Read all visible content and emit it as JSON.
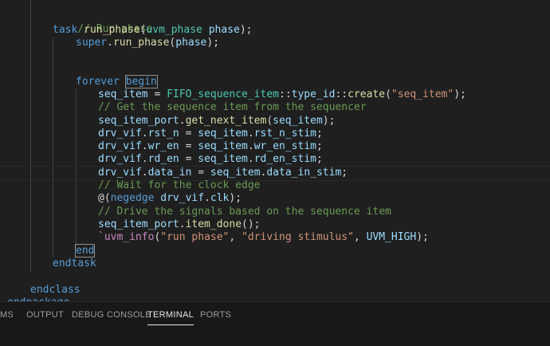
{
  "code": {
    "c1": "// Run phase",
    "task_kw": "task",
    "task_fn": "run_phase",
    "task_type": "uvm_phase",
    "task_arg": "phase",
    "super_kw": "super",
    "super_call": "run_phase",
    "super_arg": "phase",
    "forever_kw": "forever",
    "begin_kw": "begin",
    "seq_item": "seq_item",
    "fifo_type": "FIFO_sequence_item",
    "type_id": "type_id",
    "create_fn": "create",
    "seq_str": "\"seq_item\"",
    "c2": "// Get the sequence item from the sequencer",
    "port": "seq_item_port",
    "get_next": "get_next_item",
    "drv_vif": "drv_vif",
    "rst_n": "rst_n",
    "rst_n_stim": "rst_n_stim",
    "wr_en": "wr_en",
    "wr_en_stim": "wr_en_stim",
    "rd_en": "rd_en",
    "rd_en_stim": "rd_en_stim",
    "data_in": "data_in",
    "data_in_stim": "data_in_stim",
    "c3": "// Wait for the clock edge",
    "negedge_kw": "negedge",
    "clk": "clk",
    "c4": "// Drive the signals based on the sequence item",
    "item_done": "item_done",
    "uvm_info": "`uvm_info",
    "info_s1": "\"run phase\"",
    "info_s2": "\"driving stimulus\"",
    "uvm_high": "UVM_HIGH",
    "end_kw": "end",
    "endtask_kw": "endtask",
    "endclass_kw": "endclass",
    "endpackage_kw": "endpackage"
  },
  "panel": {
    "tabs": [
      {
        "label": "MS"
      },
      {
        "label": "OUTPUT"
      },
      {
        "label": "DEBUG CONSOLE"
      },
      {
        "label": "TERMINAL"
      },
      {
        "label": "PORTS"
      }
    ],
    "active": "TERMINAL"
  }
}
